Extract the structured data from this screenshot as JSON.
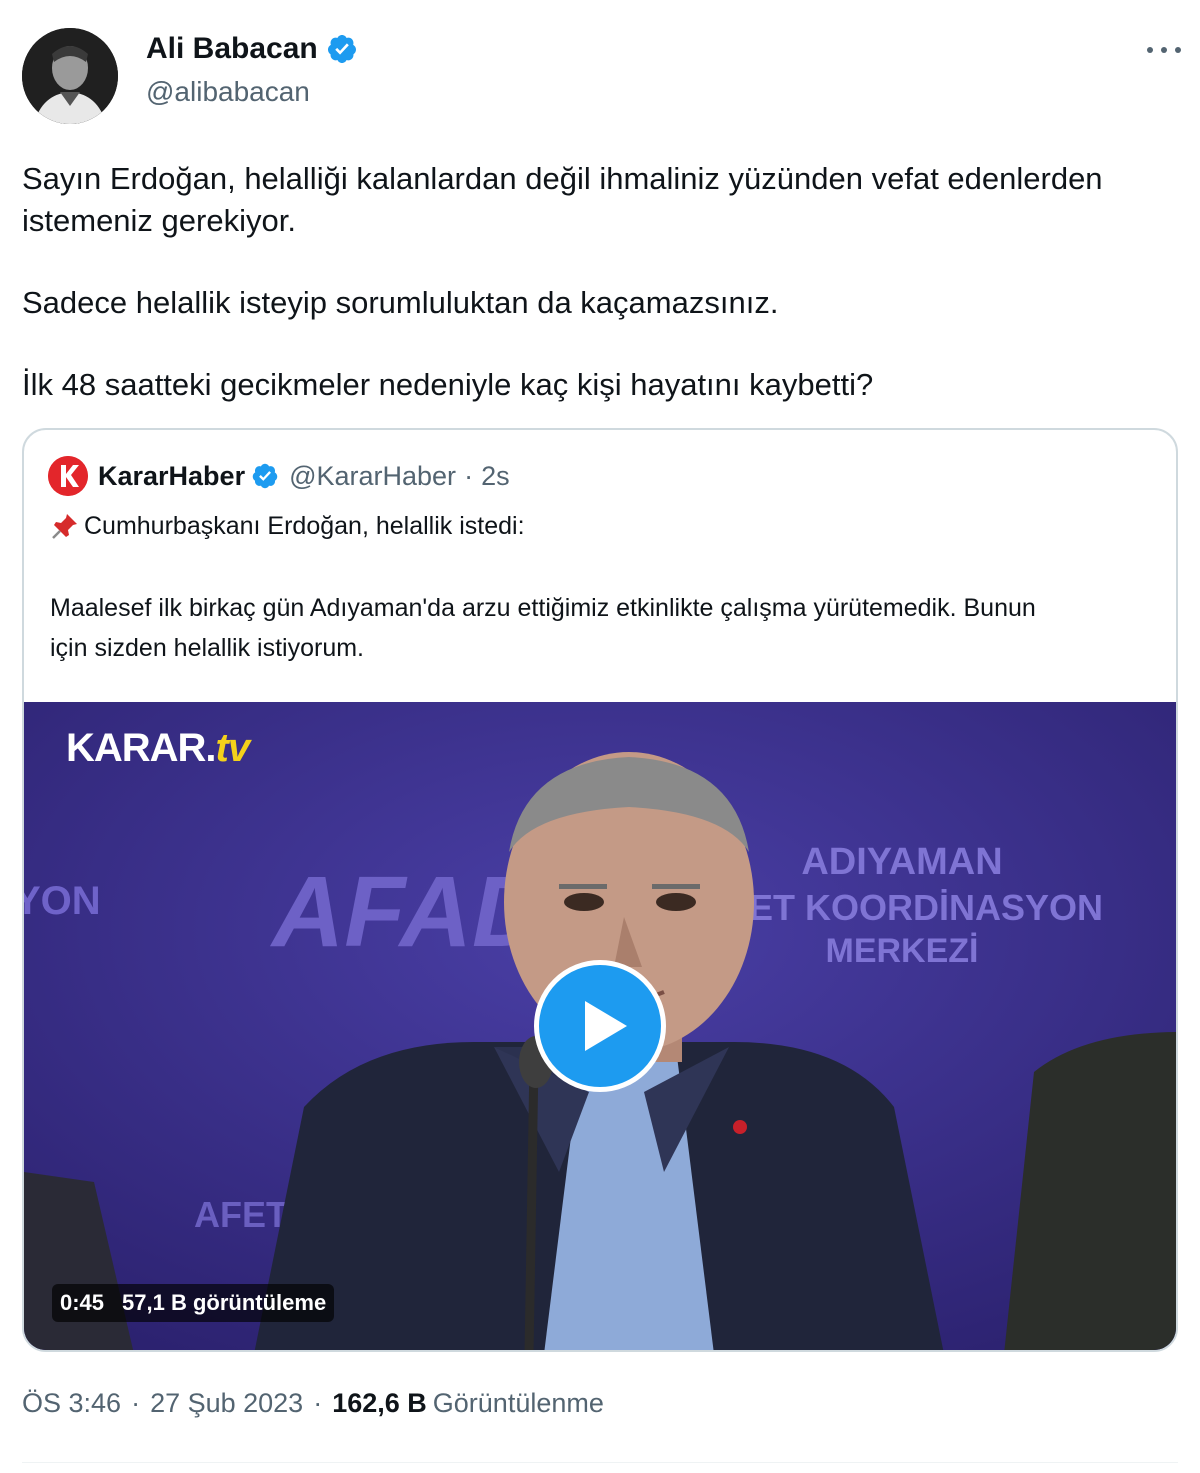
{
  "author": {
    "name": "Ali Babacan",
    "handle": "@alibabacan",
    "verified": true,
    "avatar_icon": "profile-photo"
  },
  "more_icon": "more-dots-icon",
  "tweet": {
    "paragraph1": "Sayın Erdoğan, helalliği kalanlardan değil ihmaliniz yüzünden vefat edenlerden istemeniz gerekiyor.",
    "paragraph2": "Sadece helallik isteyip sorumluluktan da kaçamazsınız.",
    "paragraph3": "İlk 48 saatteki gecikmeler nedeniyle kaç kişi hayatını kaybetti?"
  },
  "quoted": {
    "name": "KararHaber",
    "handle": "@KararHaber",
    "separator": "·",
    "time": "2s",
    "line1": "Cumhurbaşkanı Erdoğan, helallik istedi:",
    "line2": "Maalesef ilk birkaç gün Adıyaman'da arzu ettiğimiz etkinlikte çalışma yürütemedik. Bunun için sizden helallik istiyorum.",
    "video": {
      "brand_main": "KARAR.",
      "brand_accent": "tv",
      "backdrop_text_1": "ADIYAMAN",
      "backdrop_text_2": "AFET KOORDİNASYON",
      "backdrop_text_3": "MERKEZİ",
      "backdrop_logo": "AFAD",
      "duration": "0:45",
      "views": "57,1 B görüntüleme"
    }
  },
  "meta": {
    "time": "ÖS 3:46",
    "separator": "·",
    "date": "27 Şub 2023",
    "views_count": "162,6 B",
    "views_label": "Görüntülenme"
  },
  "colors": {
    "verified_blue": "#1d9bf0",
    "secondary_text": "#536471",
    "video_background": "#3a2f8a",
    "brand_red": "#e3262b"
  }
}
